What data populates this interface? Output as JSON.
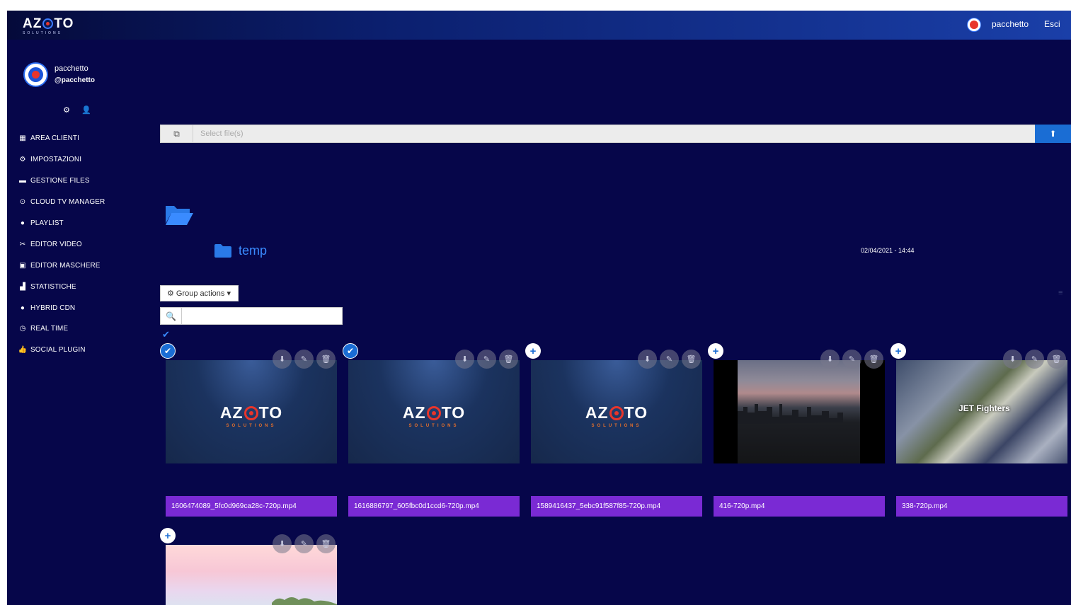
{
  "header": {
    "logo_text_a": "AZ",
    "logo_text_b": "TO",
    "logo_sub": "SOLUTIONS",
    "username": "pacchetto",
    "logout": "Esci"
  },
  "profile": {
    "name": "pacchetto",
    "handle": "@pacchetto",
    "settings_icon": "⚙",
    "user_icon": "👤"
  },
  "nav": [
    {
      "icon": "▦",
      "label": "AREA CLIENTI"
    },
    {
      "icon": "⚙",
      "label": "IMPOSTAZIONI"
    },
    {
      "icon": "▬",
      "label": "GESTIONE FILES"
    },
    {
      "icon": "⊙",
      "label": "CLOUD TV MANAGER"
    },
    {
      "icon": "●",
      "label": "PLAYLIST"
    },
    {
      "icon": "✂",
      "label": "EDITOR VIDEO"
    },
    {
      "icon": "▣",
      "label": "EDITOR MASCHERE"
    },
    {
      "icon": "▟",
      "label": "STATISTICHE"
    },
    {
      "icon": "●",
      "label": "HYBRID CDN"
    },
    {
      "icon": "◷",
      "label": "REAL TIME"
    },
    {
      "icon": "👍",
      "label": "SOCIAL PLUGIN"
    }
  ],
  "upload": {
    "browse_icon": "⧉",
    "placeholder": "Select file(s)",
    "upload_icon": "⬆"
  },
  "folder": {
    "name": "temp",
    "date": "02/04/2021 - 14:44"
  },
  "toolbar": {
    "group_actions": "Group actions",
    "search_icon": "🔍",
    "search_value": "",
    "list_icon": "≡"
  },
  "media": [
    {
      "file": "1606474089_5fc0d969ca28c-720p.mp4",
      "selected": true,
      "thumb": "azoto"
    },
    {
      "file": "1616886797_605fbc0d1ccd6-720p.mp4",
      "selected": true,
      "thumb": "azoto"
    },
    {
      "file": "1589416437_5ebc91f587f85-720p.mp4",
      "selected": false,
      "thumb": "azoto"
    },
    {
      "file": "416-720p.mp4",
      "selected": false,
      "thumb": "city"
    },
    {
      "file": "338-720p.mp4",
      "selected": false,
      "thumb": "jet",
      "overlay": "JET Fighters"
    },
    {
      "file": "",
      "selected": false,
      "thumb": "sky2"
    }
  ],
  "colors": {
    "background": "#06064a",
    "accent": "#1a6dd4",
    "filename_bar": "#7a2ad4",
    "brand_red": "#e8352b"
  }
}
